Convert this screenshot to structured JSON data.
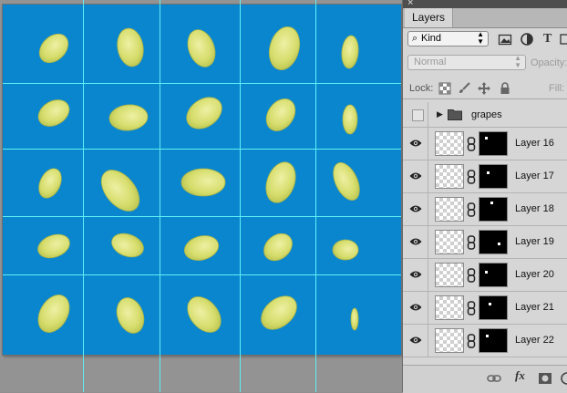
{
  "panel": {
    "close_glyph": "×",
    "tab_label": "Layers",
    "filter": {
      "kind_label": "Kind",
      "search_glyph": "⌕",
      "icons": [
        "image-filter-icon",
        "adjustment-filter-icon",
        "type-filter-icon",
        "shape-filter-icon"
      ]
    },
    "type_glyph": "T",
    "blend_mode": "Normal",
    "opacity_label": "Opacity:",
    "lock_label": "Lock:",
    "fill_label": "Fill:",
    "group": {
      "name": "grapes"
    },
    "layers": [
      {
        "name": "Layer 16"
      },
      {
        "name": "Layer 17"
      },
      {
        "name": "Layer 18"
      },
      {
        "name": "Layer 19"
      },
      {
        "name": "Layer 20"
      },
      {
        "name": "Layer 21"
      },
      {
        "name": "Layer 22"
      }
    ],
    "footer": {
      "fx_label": "fx"
    }
  },
  "colors": {
    "canvas_background": "#0a86cf",
    "guide": "#5ef0f4",
    "grape_fill": "#d8df72",
    "grape_edge": "#a9b447"
  }
}
